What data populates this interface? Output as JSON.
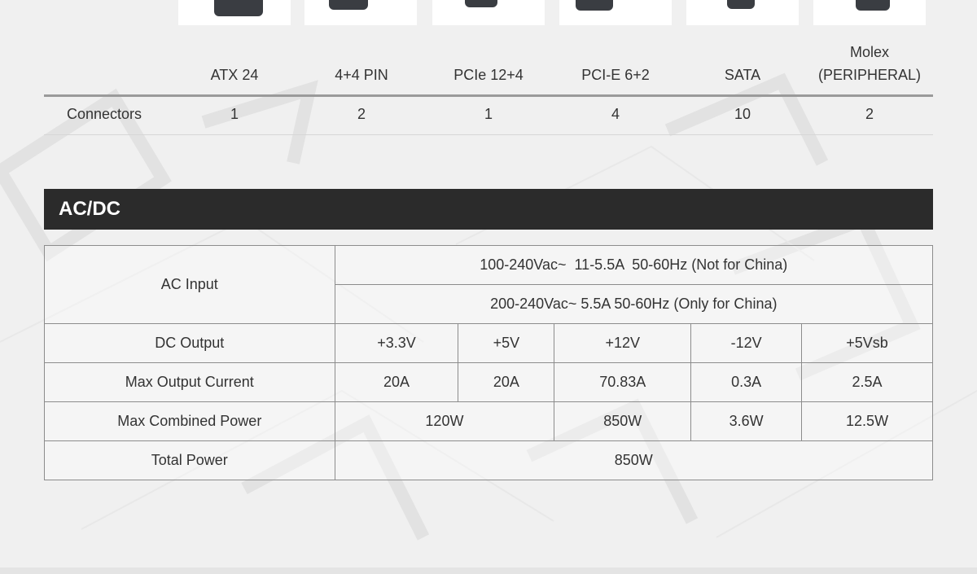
{
  "colors": {
    "header_bg": "#2b2b2b",
    "header_text": "#ffffff",
    "rule": "#9a9a9a",
    "page_bg": "#f0f0f0"
  },
  "connectors": {
    "headers": [
      "ATX 24",
      "4+4 PIN",
      "PCIe 12+4",
      "PCI-E 6+2",
      "SATA",
      "Molex (PERIPHERAL)"
    ],
    "row_label": "Connectors",
    "values": [
      "1",
      "2",
      "1",
      "4",
      "10",
      "2"
    ]
  },
  "acdc": {
    "title": "AC/DC",
    "ac_input": {
      "label": "AC Input",
      "line1": "100-240Vac~  11-5.5A  50-60Hz (Not for China)",
      "line2": "200-240Vac~ 5.5A 50-60Hz (Only for China)"
    },
    "dc_output": {
      "label": "DC Output",
      "values": [
        "+3.3V",
        "+5V",
        "+12V",
        "-12V",
        "+5Vsb"
      ]
    },
    "max_current": {
      "label": "Max Output Current",
      "values": [
        "20A",
        "20A",
        "70.83A",
        "0.3A",
        "2.5A"
      ]
    },
    "max_combined": {
      "label": "Max Combined Power",
      "values": [
        "120W",
        "850W",
        "3.6W",
        "12.5W"
      ]
    },
    "total": {
      "label": "Total Power",
      "value": "850W"
    }
  }
}
